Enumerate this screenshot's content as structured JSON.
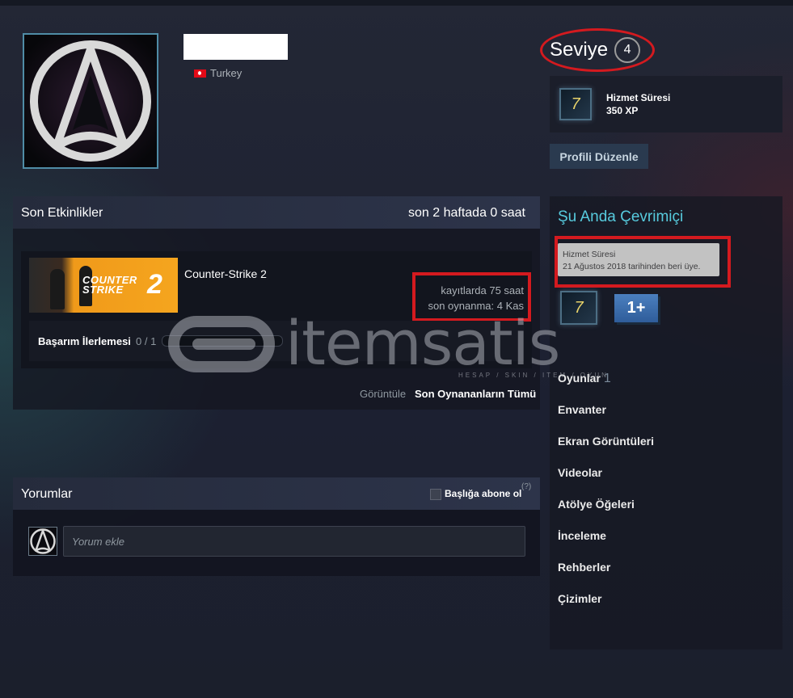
{
  "profile": {
    "country": "Turkey"
  },
  "level": {
    "label": "Seviye",
    "value": "4"
  },
  "badge": {
    "icon": "years-of-service-badge-7",
    "title": "Hizmet Süresi",
    "xp": "350 XP",
    "number": "7"
  },
  "edit_profile": "Profili Düzenle",
  "recent": {
    "title": "Son Etkinlikler",
    "hours": "son 2 haftada 0 saat",
    "game": {
      "name": "Counter-Strike 2",
      "image_text_line1": "COUNTER",
      "image_text_line2": "STRIKE",
      "image_number": "2",
      "hours_on_record": "kayıtlarda 75 saat",
      "last_played": "son oynanma: 4 Kas",
      "achievement_label": "Başarım İlerlemesi",
      "achievement_count": "0 / 1"
    },
    "view_label": "Görüntüle",
    "view_all": "Son Oynananların Tümü"
  },
  "sidebar": {
    "online_title": "Şu Anda Çevrimiçi",
    "tooltip_title": "Hizmet Süresi",
    "tooltip_text": "21 Ağustos 2018 tarihinden beri üye.",
    "plus_badge": "1+",
    "links": [
      {
        "label": "Oyunlar",
        "count": "1"
      },
      {
        "label": "Envanter"
      },
      {
        "label": "Ekran Görüntüleri"
      },
      {
        "label": "Videolar"
      },
      {
        "label": "Atölye Öğeleri"
      },
      {
        "label": "İnceleme"
      },
      {
        "label": "Rehberler"
      },
      {
        "label": "Çizimler"
      }
    ]
  },
  "comments": {
    "title": "Yorumlar",
    "subscribe": "Başlığa abone ol",
    "help": "(?)",
    "placeholder": "Yorum ekle"
  },
  "watermark": {
    "text": "itemsatis",
    "subtext": "HESAP / SKIN / ITEM / OYUN"
  },
  "colors": {
    "accent_online": "#57cbde",
    "highlight_red": "#d41a1f",
    "background": "#1c2031"
  }
}
